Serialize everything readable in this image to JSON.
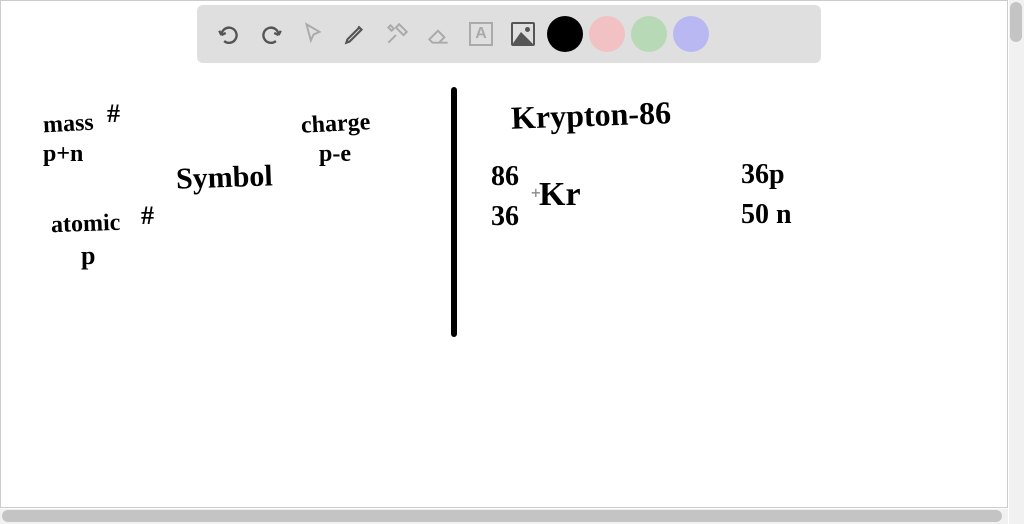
{
  "toolbar": {
    "colors": {
      "black": "#000000",
      "pink": "#f1c1c3",
      "green": "#b7d9b5",
      "purple": "#b9b8f2"
    },
    "text_letter": "A"
  },
  "notes": {
    "left": {
      "mass_label": "mass",
      "hash1": "#",
      "pn": "p+n",
      "symbol": "Symbol",
      "charge": "charge",
      "pe": "p-e",
      "atomic": "atomic",
      "hash2": "#",
      "p": "p"
    },
    "right": {
      "title": "Krypton-86",
      "mass_num": "86",
      "atomic_num": "36",
      "element": "Kr",
      "protons": "36p",
      "neutrons": "50 n"
    }
  },
  "cursor": "+"
}
